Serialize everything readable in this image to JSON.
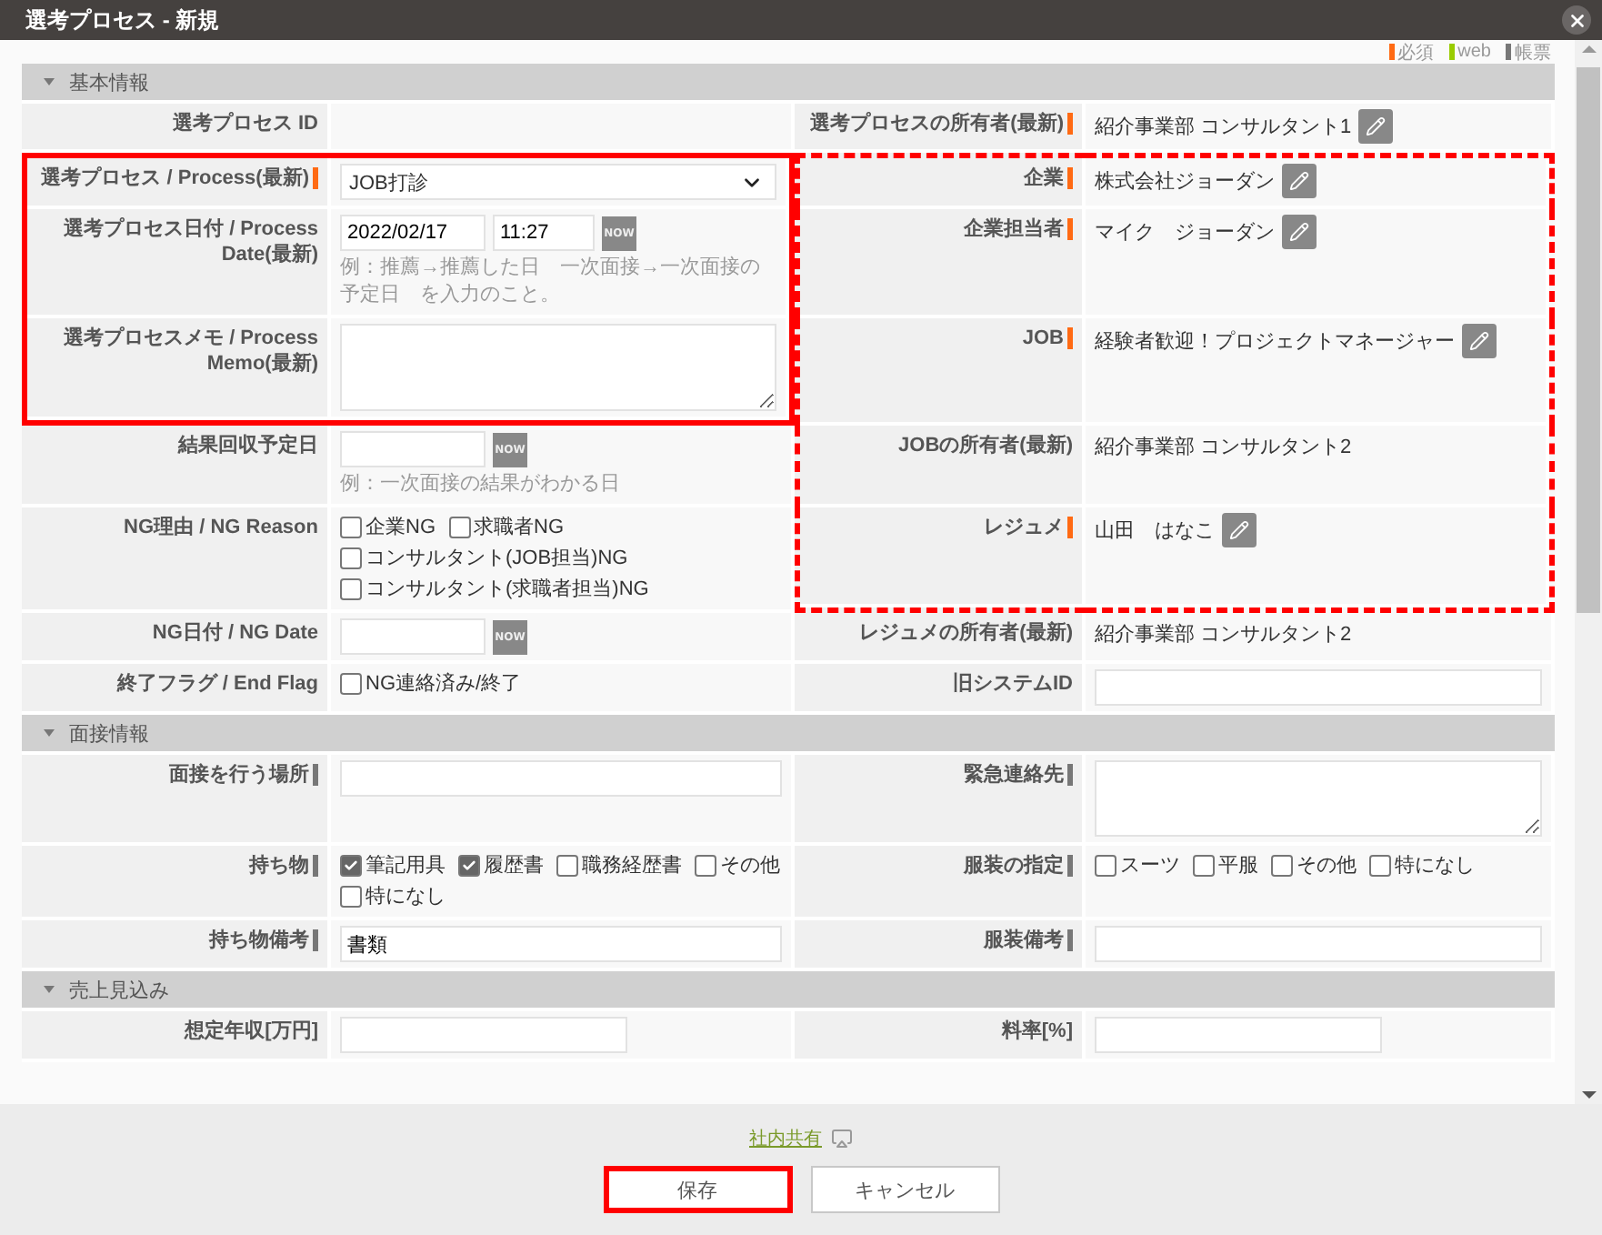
{
  "window": {
    "title": "選考プロセス - 新規"
  },
  "legend": [
    {
      "label": "必須",
      "kind": "required",
      "color": "#ff6a13"
    },
    {
      "label": "web",
      "kind": "web",
      "color": "#99cc00"
    },
    {
      "label": "帳票",
      "kind": "report",
      "color": "#777777"
    }
  ],
  "sections": [
    {
      "title": "基本情報",
      "expanded": true,
      "rows": [
        {
          "left": {
            "label": "選考プロセス ID",
            "kind": "empty"
          },
          "right": {
            "label": "選考プロセスの所有者(最新)",
            "required": true,
            "kind": "text",
            "value": "紹介事業部 コンサルタント1",
            "editable": true
          }
        },
        {
          "left": {
            "label": "選考プロセス / Process(最新)",
            "required": true,
            "kind": "select",
            "value": "JOB打診",
            "highlighted": true,
            "dashed": false
          },
          "right": {
            "label": "企業",
            "required": true,
            "kind": "text",
            "value": "株式会社ジョーダン",
            "editable": true,
            "highlighted": true,
            "dashed": true
          }
        },
        {
          "left": {
            "label": "選考プロセス日付 / Process Date(最新)",
            "kind": "datetime",
            "date": "2022/02/17",
            "time": "11:27",
            "now": "NOW",
            "hint": "例：推薦→推薦した日　一次面接→一次面接の予定日　を入力のこと。",
            "highlighted": true,
            "dashed": false
          },
          "right": {
            "label": "企業担当者",
            "required": true,
            "kind": "text",
            "value": "マイク　ジョーダン",
            "editable": true,
            "highlighted": true,
            "dashed": true
          }
        },
        {
          "left": {
            "label": "選考プロセスメモ / Process Memo(最新)",
            "kind": "textarea",
            "highlighted": true,
            "dashed": false
          },
          "right": {
            "label": "JOB",
            "required": true,
            "kind": "text",
            "value": "経験者歓迎！プロジェクトマネージャー",
            "editable": true,
            "highlighted": true,
            "dashed": true
          }
        },
        {
          "left": {
            "label": "結果回収予定日",
            "kind": "datetime",
            "now": "NOW",
            "hint": "例：一次面接の結果がわかる日"
          },
          "right": {
            "label": "JOBの所有者(最新)",
            "kind": "text",
            "value": "紹介事業部 コンサルタント2",
            "editable": false,
            "highlighted": true,
            "dashed": true
          }
        },
        {
          "left": {
            "label": "NG理由 / NG Reason",
            "kind": "checkboxes",
            "options": [
              {
                "label": "企業NG",
                "checked": false
              },
              {
                "label": "求職者NG",
                "checked": false
              },
              {
                "label": "コンサルタント(JOB担当)NG",
                "checked": false
              },
              {
                "label": "コンサルタント(求職者担当)NG",
                "checked": false
              }
            ]
          },
          "right": {
            "label": "レジュメ",
            "required": true,
            "kind": "text",
            "value": "山田　はなこ",
            "editable": true,
            "highlighted": true,
            "dashed": true
          }
        },
        {
          "left": {
            "label": "NG日付 / NG Date",
            "kind": "datetime",
            "now": "NOW"
          },
          "right": {
            "label": "レジュメの所有者(最新)",
            "kind": "text",
            "value": "紹介事業部 コンサルタント2",
            "editable": false
          }
        },
        {
          "left": {
            "label": "終了フラグ / End Flag",
            "kind": "checkboxes",
            "options": [
              {
                "label": "NG連絡済み/終了",
                "checked": false
              }
            ]
          },
          "right": {
            "label": "旧システムID",
            "kind": "input"
          }
        }
      ]
    },
    {
      "title": "面接情報",
      "expanded": true,
      "rows": [
        {
          "left": {
            "label": "面接を行う場所",
            "report": true,
            "kind": "input"
          },
          "right": {
            "label": "緊急連絡先",
            "report": true,
            "kind": "textarea"
          }
        },
        {
          "left": {
            "label": "持ち物",
            "report": true,
            "kind": "checkboxes",
            "options": [
              {
                "label": "筆記用具",
                "checked": true
              },
              {
                "label": "履歴書",
                "checked": true
              },
              {
                "label": "職務経歴書",
                "checked": false
              },
              {
                "label": "その他",
                "checked": false
              },
              {
                "label": "特になし",
                "checked": false
              }
            ]
          },
          "right": {
            "label": "服装の指定",
            "report": true,
            "kind": "checkboxes",
            "options": [
              {
                "label": "スーツ",
                "checked": false
              },
              {
                "label": "平服",
                "checked": false
              },
              {
                "label": "その他",
                "checked": false
              },
              {
                "label": "特になし",
                "checked": false
              }
            ]
          }
        },
        {
          "left": {
            "label": "持ち物備考",
            "report": true,
            "kind": "input",
            "value": "書類"
          },
          "right": {
            "label": "服装備考",
            "report": true,
            "kind": "input"
          }
        }
      ]
    },
    {
      "title": "売上見込み",
      "expanded": true,
      "rows": [
        {
          "left": {
            "label": "想定年収[万円]",
            "kind": "short-input"
          },
          "right": {
            "label": "料率[%]",
            "kind": "short-input"
          }
        }
      ]
    }
  ],
  "footer": {
    "link": "社内共有",
    "buttons": [
      {
        "label": "保存",
        "highlighted": true
      },
      {
        "label": "キャンセル",
        "highlighted": false
      }
    ]
  }
}
